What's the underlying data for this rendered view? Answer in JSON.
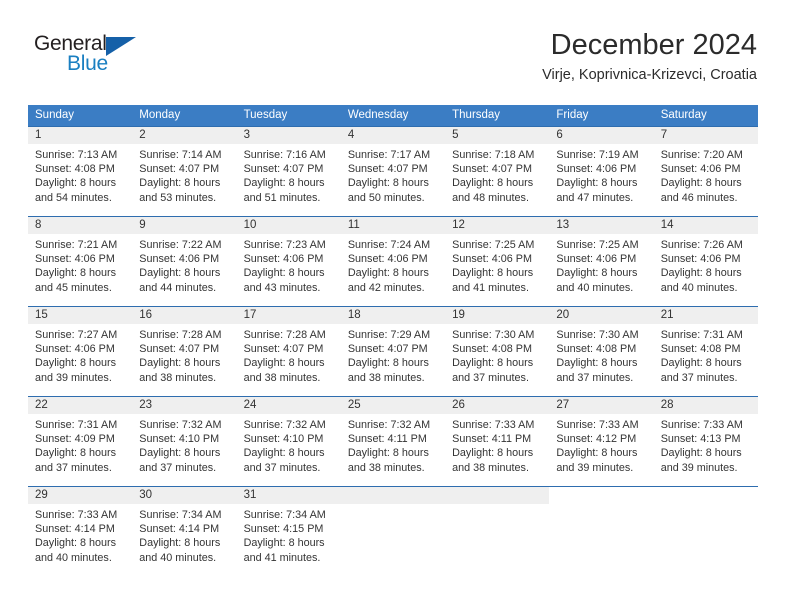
{
  "brand": {
    "name_top": "General",
    "name_bottom": "Blue",
    "triangle_color": "#1560a8",
    "blue_color": "#1a7fc1",
    "dark_color": "#231f20"
  },
  "header": {
    "title": "December 2024",
    "subtitle": "Virje, Koprivnica-Krizevci, Croatia"
  },
  "theme": {
    "header_bar_color": "#3b7dc4",
    "week_divider_color": "#2e6daf",
    "daynum_band_color": "#efefef",
    "text_color": "#343434"
  },
  "weekday_headers": [
    "Sunday",
    "Monday",
    "Tuesday",
    "Wednesday",
    "Thursday",
    "Friday",
    "Saturday"
  ],
  "labels": {
    "sunrise_prefix": "Sunrise: ",
    "sunset_prefix": "Sunset: ",
    "daylight_prefix": "Daylight: "
  },
  "weeks": [
    {
      "days": [
        {
          "num": "1",
          "sunrise": "Sunrise: 7:13 AM",
          "sunset": "Sunset: 4:08 PM",
          "daylight1": "Daylight: 8 hours",
          "daylight2": "and 54 minutes."
        },
        {
          "num": "2",
          "sunrise": "Sunrise: 7:14 AM",
          "sunset": "Sunset: 4:07 PM",
          "daylight1": "Daylight: 8 hours",
          "daylight2": "and 53 minutes."
        },
        {
          "num": "3",
          "sunrise": "Sunrise: 7:16 AM",
          "sunset": "Sunset: 4:07 PM",
          "daylight1": "Daylight: 8 hours",
          "daylight2": "and 51 minutes."
        },
        {
          "num": "4",
          "sunrise": "Sunrise: 7:17 AM",
          "sunset": "Sunset: 4:07 PM",
          "daylight1": "Daylight: 8 hours",
          "daylight2": "and 50 minutes."
        },
        {
          "num": "5",
          "sunrise": "Sunrise: 7:18 AM",
          "sunset": "Sunset: 4:07 PM",
          "daylight1": "Daylight: 8 hours",
          "daylight2": "and 48 minutes."
        },
        {
          "num": "6",
          "sunrise": "Sunrise: 7:19 AM",
          "sunset": "Sunset: 4:06 PM",
          "daylight1": "Daylight: 8 hours",
          "daylight2": "and 47 minutes."
        },
        {
          "num": "7",
          "sunrise": "Sunrise: 7:20 AM",
          "sunset": "Sunset: 4:06 PM",
          "daylight1": "Daylight: 8 hours",
          "daylight2": "and 46 minutes."
        }
      ]
    },
    {
      "days": [
        {
          "num": "8",
          "sunrise": "Sunrise: 7:21 AM",
          "sunset": "Sunset: 4:06 PM",
          "daylight1": "Daylight: 8 hours",
          "daylight2": "and 45 minutes."
        },
        {
          "num": "9",
          "sunrise": "Sunrise: 7:22 AM",
          "sunset": "Sunset: 4:06 PM",
          "daylight1": "Daylight: 8 hours",
          "daylight2": "and 44 minutes."
        },
        {
          "num": "10",
          "sunrise": "Sunrise: 7:23 AM",
          "sunset": "Sunset: 4:06 PM",
          "daylight1": "Daylight: 8 hours",
          "daylight2": "and 43 minutes."
        },
        {
          "num": "11",
          "sunrise": "Sunrise: 7:24 AM",
          "sunset": "Sunset: 4:06 PM",
          "daylight1": "Daylight: 8 hours",
          "daylight2": "and 42 minutes."
        },
        {
          "num": "12",
          "sunrise": "Sunrise: 7:25 AM",
          "sunset": "Sunset: 4:06 PM",
          "daylight1": "Daylight: 8 hours",
          "daylight2": "and 41 minutes."
        },
        {
          "num": "13",
          "sunrise": "Sunrise: 7:25 AM",
          "sunset": "Sunset: 4:06 PM",
          "daylight1": "Daylight: 8 hours",
          "daylight2": "and 40 minutes."
        },
        {
          "num": "14",
          "sunrise": "Sunrise: 7:26 AM",
          "sunset": "Sunset: 4:06 PM",
          "daylight1": "Daylight: 8 hours",
          "daylight2": "and 40 minutes."
        }
      ]
    },
    {
      "days": [
        {
          "num": "15",
          "sunrise": "Sunrise: 7:27 AM",
          "sunset": "Sunset: 4:06 PM",
          "daylight1": "Daylight: 8 hours",
          "daylight2": "and 39 minutes."
        },
        {
          "num": "16",
          "sunrise": "Sunrise: 7:28 AM",
          "sunset": "Sunset: 4:07 PM",
          "daylight1": "Daylight: 8 hours",
          "daylight2": "and 38 minutes."
        },
        {
          "num": "17",
          "sunrise": "Sunrise: 7:28 AM",
          "sunset": "Sunset: 4:07 PM",
          "daylight1": "Daylight: 8 hours",
          "daylight2": "and 38 minutes."
        },
        {
          "num": "18",
          "sunrise": "Sunrise: 7:29 AM",
          "sunset": "Sunset: 4:07 PM",
          "daylight1": "Daylight: 8 hours",
          "daylight2": "and 38 minutes."
        },
        {
          "num": "19",
          "sunrise": "Sunrise: 7:30 AM",
          "sunset": "Sunset: 4:08 PM",
          "daylight1": "Daylight: 8 hours",
          "daylight2": "and 37 minutes."
        },
        {
          "num": "20",
          "sunrise": "Sunrise: 7:30 AM",
          "sunset": "Sunset: 4:08 PM",
          "daylight1": "Daylight: 8 hours",
          "daylight2": "and 37 minutes."
        },
        {
          "num": "21",
          "sunrise": "Sunrise: 7:31 AM",
          "sunset": "Sunset: 4:08 PM",
          "daylight1": "Daylight: 8 hours",
          "daylight2": "and 37 minutes."
        }
      ]
    },
    {
      "days": [
        {
          "num": "22",
          "sunrise": "Sunrise: 7:31 AM",
          "sunset": "Sunset: 4:09 PM",
          "daylight1": "Daylight: 8 hours",
          "daylight2": "and 37 minutes."
        },
        {
          "num": "23",
          "sunrise": "Sunrise: 7:32 AM",
          "sunset": "Sunset: 4:10 PM",
          "daylight1": "Daylight: 8 hours",
          "daylight2": "and 37 minutes."
        },
        {
          "num": "24",
          "sunrise": "Sunrise: 7:32 AM",
          "sunset": "Sunset: 4:10 PM",
          "daylight1": "Daylight: 8 hours",
          "daylight2": "and 37 minutes."
        },
        {
          "num": "25",
          "sunrise": "Sunrise: 7:32 AM",
          "sunset": "Sunset: 4:11 PM",
          "daylight1": "Daylight: 8 hours",
          "daylight2": "and 38 minutes."
        },
        {
          "num": "26",
          "sunrise": "Sunrise: 7:33 AM",
          "sunset": "Sunset: 4:11 PM",
          "daylight1": "Daylight: 8 hours",
          "daylight2": "and 38 minutes."
        },
        {
          "num": "27",
          "sunrise": "Sunrise: 7:33 AM",
          "sunset": "Sunset: 4:12 PM",
          "daylight1": "Daylight: 8 hours",
          "daylight2": "and 39 minutes."
        },
        {
          "num": "28",
          "sunrise": "Sunrise: 7:33 AM",
          "sunset": "Sunset: 4:13 PM",
          "daylight1": "Daylight: 8 hours",
          "daylight2": "and 39 minutes."
        }
      ]
    },
    {
      "days": [
        {
          "num": "29",
          "sunrise": "Sunrise: 7:33 AM",
          "sunset": "Sunset: 4:14 PM",
          "daylight1": "Daylight: 8 hours",
          "daylight2": "and 40 minutes."
        },
        {
          "num": "30",
          "sunrise": "Sunrise: 7:34 AM",
          "sunset": "Sunset: 4:14 PM",
          "daylight1": "Daylight: 8 hours",
          "daylight2": "and 40 minutes."
        },
        {
          "num": "31",
          "sunrise": "Sunrise: 7:34 AM",
          "sunset": "Sunset: 4:15 PM",
          "daylight1": "Daylight: 8 hours",
          "daylight2": "and 41 minutes."
        },
        {
          "num": "",
          "sunrise": "",
          "sunset": "",
          "daylight1": "",
          "daylight2": ""
        },
        {
          "num": "",
          "sunrise": "",
          "sunset": "",
          "daylight1": "",
          "daylight2": ""
        },
        {
          "num": "",
          "sunrise": "",
          "sunset": "",
          "daylight1": "",
          "daylight2": ""
        },
        {
          "num": "",
          "sunrise": "",
          "sunset": "",
          "daylight1": "",
          "daylight2": ""
        }
      ]
    }
  ]
}
